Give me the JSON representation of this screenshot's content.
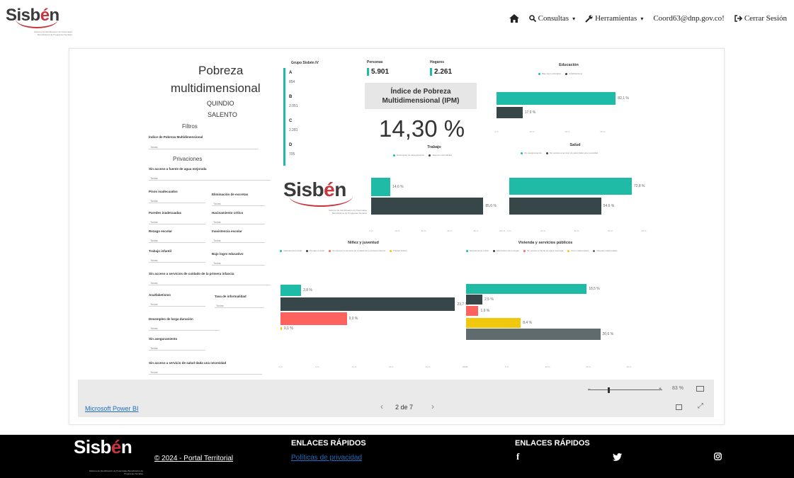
{
  "brand": {
    "logo_text_a": "Sisb",
    "logo_text_e": "é",
    "logo_text_b": "n",
    "tagline": "Sistema de Identificación de Potenciales Beneficiarios de Programas Sociales"
  },
  "nav": {
    "home_icon": "home-icon",
    "consultas": "Consultas",
    "herramientas": "Herramientas",
    "user": "Coord63@dnp.gov.co!",
    "logout": "Cerrar Sesión"
  },
  "report": {
    "title_line1": "Pobreza",
    "title_line2": "multidimensional",
    "dept": "QUINDIO",
    "muni": "SALENTO",
    "filtros": "Filtros",
    "filter_ipm_label": "Índice de Pobreza Multidimensional",
    "filter_default": "Todas",
    "privaciones": "Privaciones",
    "filters": [
      {
        "label": "Sin acceso a fuente de agua mejorada"
      },
      {
        "label": "Pisos inadecuados"
      },
      {
        "label": "Eliminación de excretas"
      },
      {
        "label": "Paredes inadecuadas"
      },
      {
        "label": "Hacinamiento crítico"
      },
      {
        "label": "Rezago escolar"
      },
      {
        "label": "Inasistencia escolar"
      },
      {
        "label": "Trabajo infantil"
      },
      {
        "label": "Bajo logro educativo"
      },
      {
        "label": "Sin acceso a servicios de cuidado de la primera infancia"
      },
      {
        "label": "Analfabetismo"
      },
      {
        "label": "Tasa de informalidad"
      },
      {
        "label": "Desempleo de larga duración"
      },
      {
        "label": "Sin aseguramiento"
      },
      {
        "label": "Sin acceso a servicio de salud dada una necesidad"
      }
    ],
    "grupo_title": "Grupo Sisbén IV",
    "grupos": [
      {
        "k": "A",
        "v": "854"
      },
      {
        "k": "B",
        "v": "2.051"
      },
      {
        "k": "C",
        "v": "2.281"
      },
      {
        "k": "D",
        "v": "705"
      }
    ],
    "personas_label": "Personas",
    "personas_value": "5.901",
    "hogares_label": "Hogares",
    "hogares_value": "2.261",
    "ipm_title": "Índice de Pobreza Multidimensional (IPM)",
    "ipm_value": "14,30 %"
  },
  "chart_data": [
    {
      "type": "bar",
      "title": "Educación",
      "series": [
        {
          "name": "Bajo logro educativo",
          "color": "#1fbba6",
          "value": 82.1
        },
        {
          "name": "Analfabetismo",
          "color": "#374649",
          "value": 17.9
        }
      ],
      "data_labels": [
        "82,1 %",
        "17,9 %"
      ],
      "xlim": [
        0,
        100
      ],
      "ticks": [
        "0 %",
        "20 %",
        "40 %",
        "60 %"
      ]
    },
    {
      "type": "bar",
      "title": "Trabajo",
      "series": [
        {
          "name": "Desempleo de larga duración",
          "color": "#1fbba6",
          "value": 14.6
        },
        {
          "name": "Tasa de informalidad",
          "color": "#374649",
          "value": 85.6
        }
      ],
      "data_labels": [
        "14,6 %",
        "85,6 %"
      ],
      "xlim": [
        0,
        100
      ],
      "ticks": [
        "0 %",
        "20 %",
        "40 %",
        "60 %",
        "80 %",
        "100 %"
      ]
    },
    {
      "type": "bar",
      "title": "Salud",
      "series": [
        {
          "name": "Sin aseguramiento",
          "color": "#1fbba6",
          "value": 72.8
        },
        {
          "name": "Sin acceso a servicio de salud dada una necesidad",
          "color": "#374649",
          "value": 54.6
        }
      ],
      "data_labels": [
        "72,8 %",
        "54,6 %"
      ],
      "xlim": [
        0,
        80
      ],
      "ticks": [
        "0 %",
        "20 %",
        "40 %",
        "60 %",
        "80 %"
      ]
    },
    {
      "type": "bar",
      "title": "Niñez y juventud",
      "series": [
        {
          "name": "Inasistencia escolar",
          "color": "#1fbba6",
          "value": 2.8
        },
        {
          "name": "Rezago escolar",
          "color": "#374649",
          "value": 23.7
        },
        {
          "name": "Sin acceso a servicios de cuidado de la primera infancia",
          "color": "#fd625e",
          "value": 9.0
        },
        {
          "name": "Trabajo infantil",
          "color": "#f2c80f",
          "value": 0.1
        }
      ],
      "data_labels": [
        "2,8 %",
        "23,7 %",
        "9,0 %",
        "0,1 %"
      ],
      "xlim": [
        0,
        25
      ],
      "ticks": [
        "0 %",
        "5 %",
        "10 %",
        "15 %",
        "20 %",
        "25 %"
      ]
    },
    {
      "type": "bar",
      "title": "Vivienda y servicios públicos",
      "series": [
        {
          "name": "Hacinamiento crítico",
          "color": "#1fbba6",
          "value": 18.5
        },
        {
          "name": "Eliminación de excretas",
          "color": "#374649",
          "value": 2.5
        },
        {
          "name": "Sin acceso a fuente de agua mejorada",
          "color": "#fd625e",
          "value": 1.9
        },
        {
          "name": "Pisos inadecuados",
          "color": "#f2c80f",
          "value": 8.4
        },
        {
          "name": "Paredes inadecuadas",
          "color": "#5f6b6d",
          "value": 20.6
        }
      ],
      "data_labels": [
        "18,5 %",
        "2,5 %",
        "1,9 %",
        "8,4 %",
        "20,6 %"
      ],
      "xlim": [
        0,
        25
      ],
      "ticks": [
        "0 %",
        "5 %",
        "10 %",
        "15 %",
        "20 %"
      ]
    }
  ],
  "powerbi": {
    "link": "Microsoft Power BI",
    "page": "2 de 7",
    "zoom": "83 %",
    "prev": "‹",
    "next": "›"
  },
  "footer": {
    "copyright": "© 2024 - Portal Territorial",
    "enlaces1": "ENLACES RÁPIDOS",
    "politicas": "Políticas de privacidad",
    "enlaces2": "ENLACES RÁPIDOS"
  }
}
